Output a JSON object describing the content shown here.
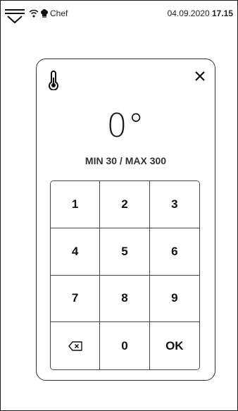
{
  "status_bar": {
    "user": "Chef",
    "date": "04.09.2020",
    "time": "17.15"
  },
  "dialog": {
    "value": "0°",
    "range": "MIN 30 / MAX 300",
    "icons": {
      "thermometer": "thermometer-icon",
      "close": "close-icon",
      "backspace": "backspace-icon"
    }
  },
  "keypad": {
    "keys": [
      "1",
      "2",
      "3",
      "4",
      "5",
      "6",
      "7",
      "8",
      "9",
      "0",
      "OK"
    ]
  }
}
